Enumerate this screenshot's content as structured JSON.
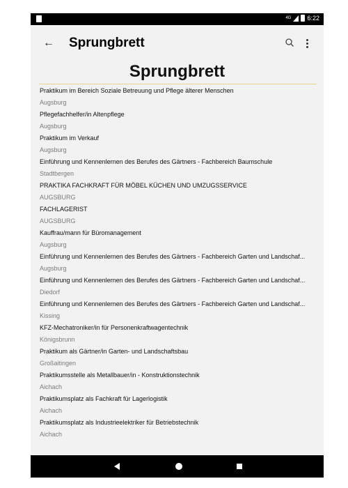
{
  "statusbar": {
    "time": "6:22",
    "network": "4G"
  },
  "appbar": {
    "title": "Sprungbrett"
  },
  "page": {
    "heading": "Sprungbrett"
  },
  "items": [
    {
      "title": "Praktikum im Bereich Soziale Betreuung und Pflege älterer Menschen",
      "location": "Augsburg"
    },
    {
      "title": "Pflegefachhelfer/in Altenpflege",
      "location": "Augsburg"
    },
    {
      "title": "Praktikum im Verkauf",
      "location": "Augsburg"
    },
    {
      "title": "Einführung und Kennenlernen des Berufes des Gärtners - Fachbereich Baumschule",
      "location": "Stadtbergen"
    },
    {
      "title": "PRAKTIKA FACHKRAFT FÜR MÖBEL KÜCHEN UND UMZUGSSERVICE",
      "location": "AUGSBURG"
    },
    {
      "title": "FACHLAGERIST",
      "location": "AUGSBURG"
    },
    {
      "title": "Kauffrau/mann für Büromanagement",
      "location": "Augsburg"
    },
    {
      "title": "Einführung und Kennenlernen des Berufes des Gärtners - Fachbereich Garten und Landschaf...",
      "location": "Augsburg"
    },
    {
      "title": "Einführung und Kennenlernen des Berufes des Gärtners - Fachbereich Garten und Landschaf...",
      "location": "Diedorf"
    },
    {
      "title": "Einführung und Kennenlernen des Berufes des Gärtners - Fachbereich Garten und Landschaf...",
      "location": "Kissing"
    },
    {
      "title": "KFZ-Mechatroniker/in für Personenkraftwagentechnik",
      "location": "Königsbrunn"
    },
    {
      "title": "Praktikum als Gärtner/in Garten- und Landschaftsbau",
      "location": "Großaitingen"
    },
    {
      "title": "Praktikumsstelle als Metallbauer/in - Konstruktionstechnik",
      "location": "Aichach"
    },
    {
      "title": "Praktikumsplatz als Fachkraft für Lagerlogistik",
      "location": "Aichach"
    },
    {
      "title": "Praktikumsplatz als Industrieelektriker für Betriebstechnik",
      "location": "Aichach"
    }
  ]
}
